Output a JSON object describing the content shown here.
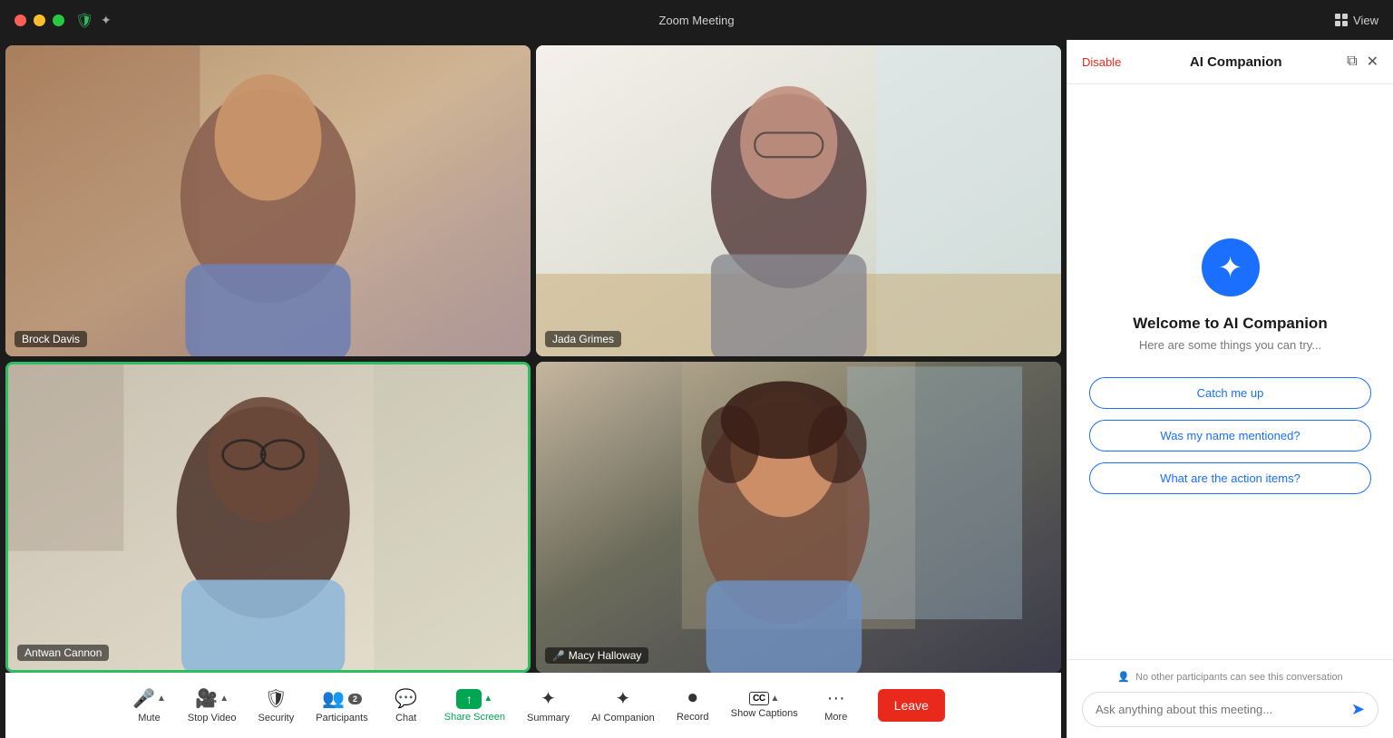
{
  "titleBar": {
    "title": "Zoom Meeting",
    "viewLabel": "View",
    "trafficLights": [
      "close",
      "minimize",
      "maximize"
    ]
  },
  "participants": [
    {
      "name": "Brock Davis",
      "bg": "bg-brock",
      "activeSpeaker": false,
      "muted": false,
      "position": "top-left"
    },
    {
      "name": "Jada Grimes",
      "bg": "bg-jada",
      "activeSpeaker": false,
      "muted": false,
      "position": "top-right"
    },
    {
      "name": "Antwan Cannon",
      "bg": "bg-antwan",
      "activeSpeaker": true,
      "muted": false,
      "position": "bottom-left"
    },
    {
      "name": "Macy Halloway",
      "bg": "bg-macy",
      "activeSpeaker": false,
      "muted": true,
      "position": "bottom-right"
    }
  ],
  "toolbar": {
    "mute": "Mute",
    "stopVideo": "Stop Video",
    "security": "Security",
    "participants": "Participants",
    "participantsCount": "2",
    "chat": "Chat",
    "shareScreen": "Share Screen",
    "summary": "Summary",
    "aiCompanion": "AI Companion",
    "record": "Record",
    "showCaptions": "Show Captions",
    "more": "More",
    "leave": "Leave"
  },
  "aiPanel": {
    "disable": "Disable",
    "title": "AI Companion",
    "welcomeTitle": "Welcome to AI Companion",
    "welcomeSub": "Here are some things you can try...",
    "suggestions": [
      "Catch me up",
      "Was my name mentioned?",
      "What are the action items?"
    ],
    "privacyNote": "No other participants can see this conversation",
    "inputPlaceholder": "Ask anything about this meeting..."
  }
}
